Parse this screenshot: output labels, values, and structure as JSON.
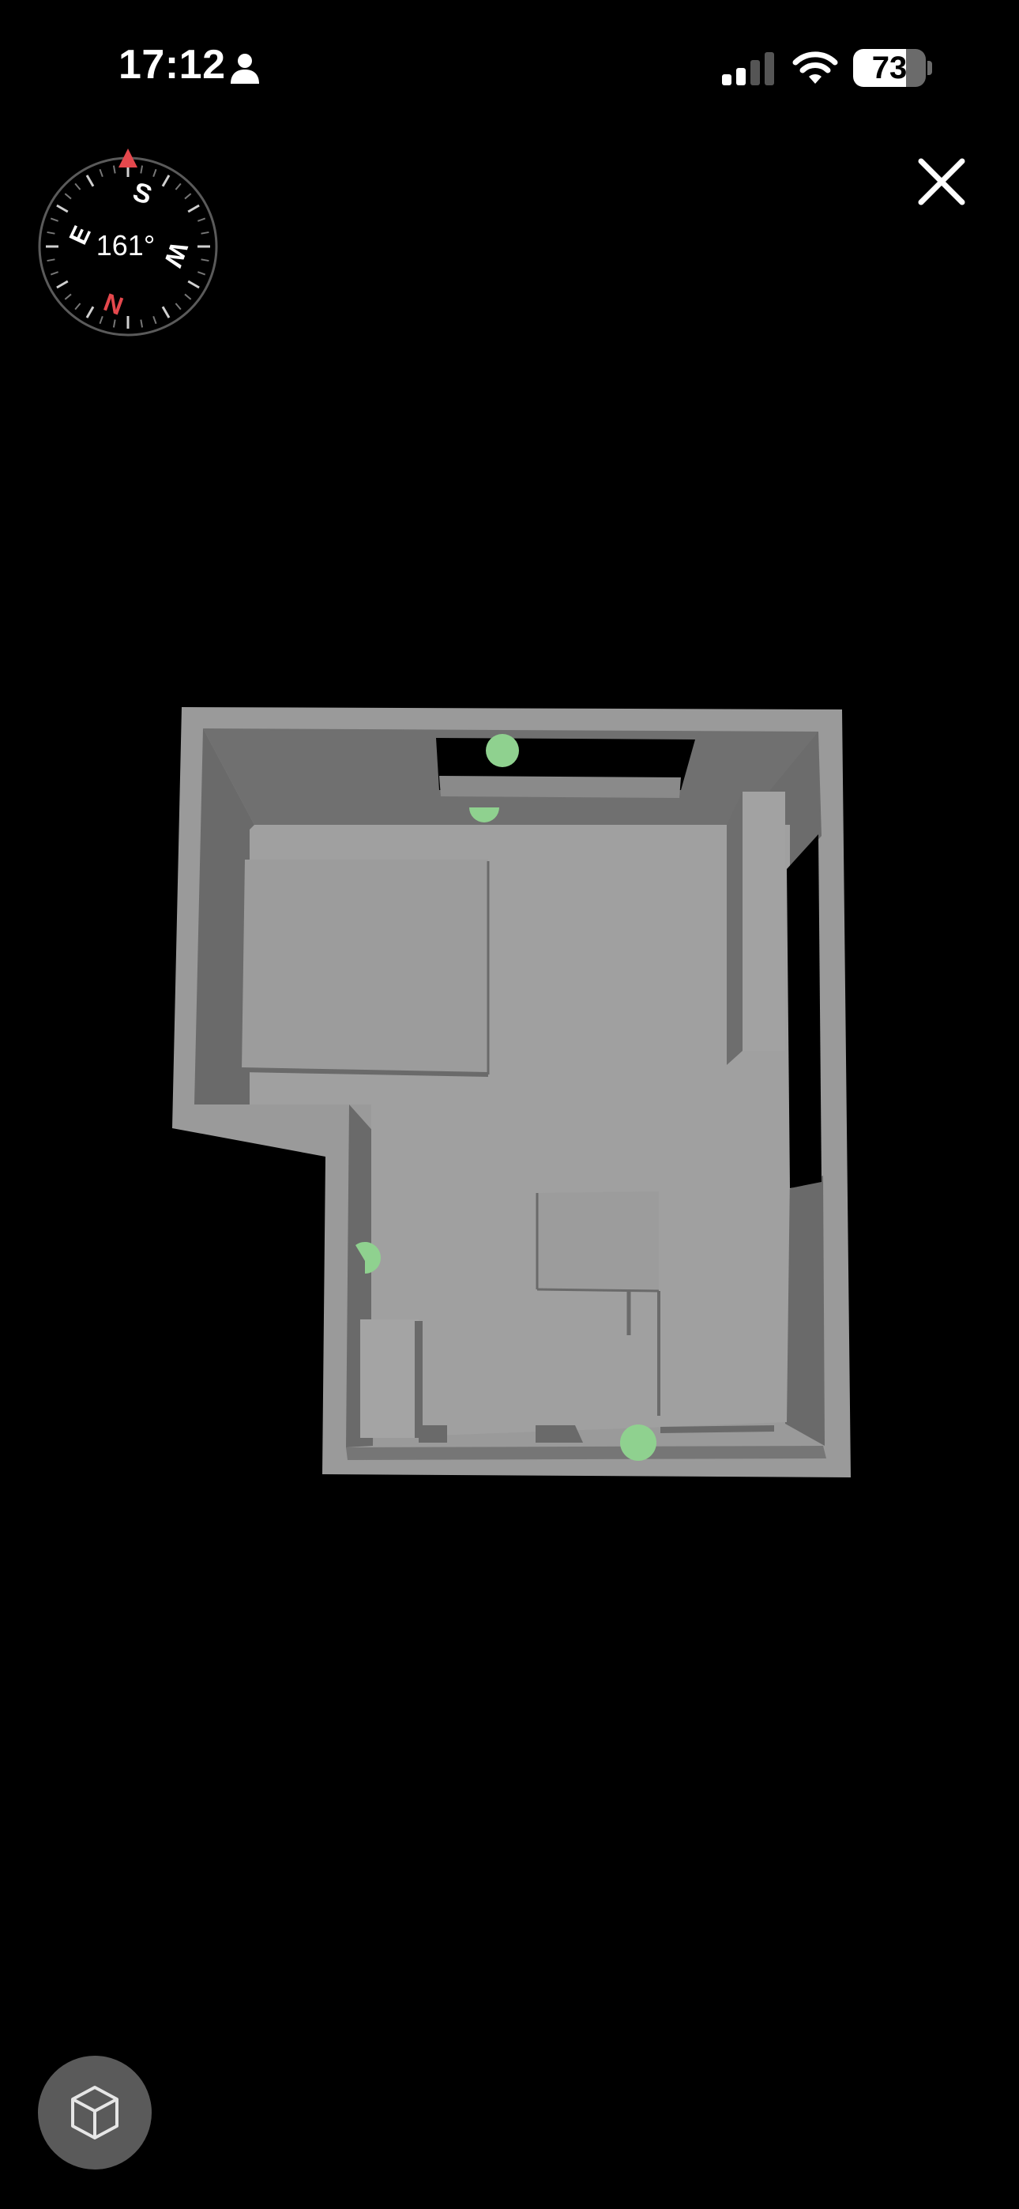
{
  "status_bar": {
    "time": "17:12",
    "battery_level": "73",
    "battery_fraction": 0.73,
    "icons": [
      "person-icon",
      "cellular-signal-icon",
      "wifi-icon",
      "battery-icon"
    ]
  },
  "compass": {
    "heading": "161°",
    "labels": {
      "north": "N",
      "south": "S",
      "east": "E",
      "west": "W"
    },
    "north_color": "#e5484d",
    "marker_color": "#e5484d"
  },
  "controls": {
    "close_icon": "close-icon",
    "view_toggle_icon": "cube-icon"
  },
  "floor_plan": {
    "wall_top_color": "#9e9e9e",
    "wall_side_color": "#6e6e6e",
    "floor_color": "#a0a0a0",
    "opening_marker_color": "#8fd18f"
  }
}
